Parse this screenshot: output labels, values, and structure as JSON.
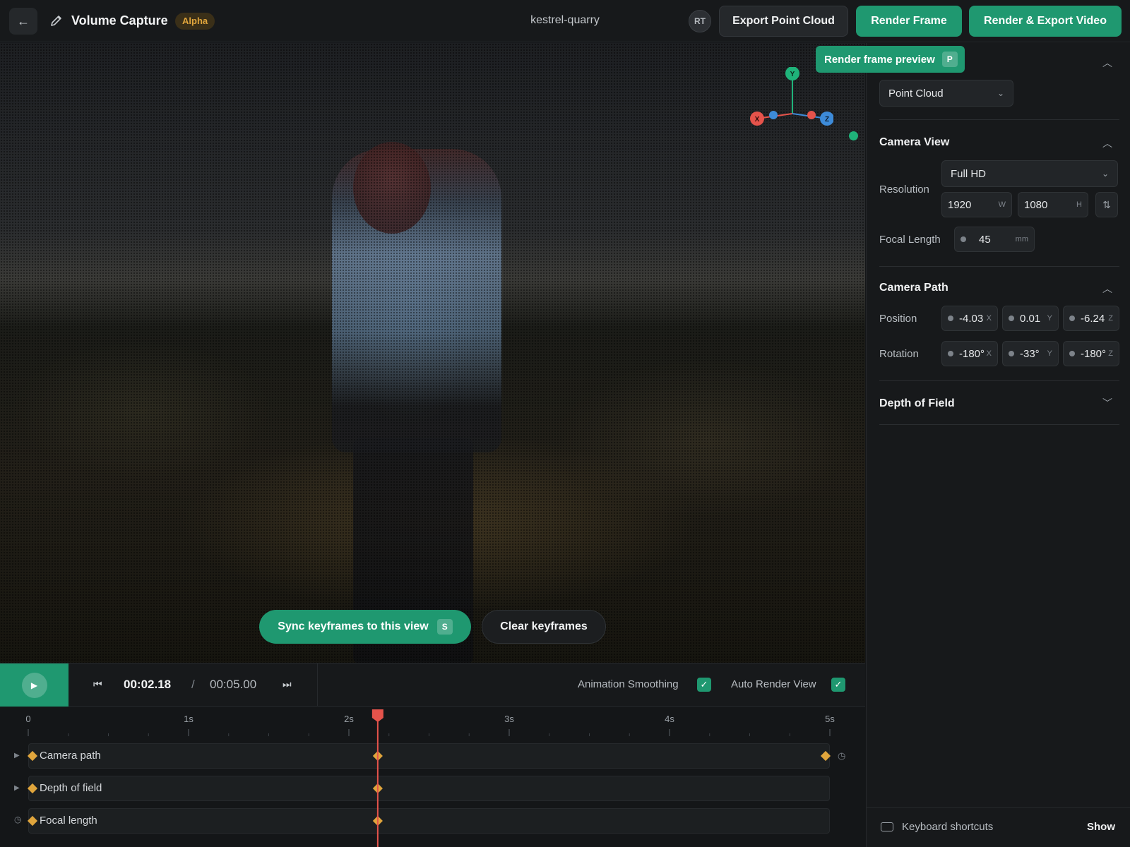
{
  "header": {
    "app_title": "Volume Capture",
    "badge": "Alpha",
    "project_name": "kestrel-quarry",
    "avatar_initials": "RT",
    "export_point_cloud": "Export Point Cloud",
    "render_frame": "Render Frame",
    "render_export_video": "Render & Export Video"
  },
  "viewport": {
    "tooltip_label": "Render frame preview",
    "tooltip_shortcut": "P",
    "gizmo_axes": [
      "X",
      "Y",
      "Z"
    ],
    "sync_label": "Sync keyframes to this view",
    "sync_shortcut": "S",
    "clear_label": "Clear keyframes"
  },
  "panel": {
    "render_mode": "Point Cloud",
    "camera_view": {
      "title": "Camera View",
      "resolution_label": "Resolution",
      "resolution_preset": "Full HD",
      "width": "1920",
      "width_suffix": "W",
      "height": "1080",
      "height_suffix": "H",
      "focal_label": "Focal Length",
      "focal_value": "45",
      "focal_unit": "mm"
    },
    "camera_path": {
      "title": "Camera Path",
      "position_label": "Position",
      "position": [
        {
          "value": "-4.03",
          "axis": "X"
        },
        {
          "value": "0.01",
          "axis": "Y"
        },
        {
          "value": "-6.24",
          "axis": "Z"
        }
      ],
      "rotation_label": "Rotation",
      "rotation": [
        {
          "value": "-180°",
          "axis": "X"
        },
        {
          "value": "-33°",
          "axis": "Y"
        },
        {
          "value": "-180°",
          "axis": "Z"
        }
      ]
    },
    "depth_of_field_title": "Depth of Field",
    "keyboard_shortcuts": "Keyboard shortcuts",
    "show_label": "Show"
  },
  "playback": {
    "current_time": "00:02.18",
    "separator": "/",
    "total_time": "00:05.00",
    "animation_smoothing": "Animation Smoothing",
    "animation_smoothing_on": true,
    "auto_render_view": "Auto Render View",
    "auto_render_view_on": true
  },
  "timeline": {
    "ticks": [
      "0",
      "1s",
      "2s",
      "3s",
      "4s",
      "5s"
    ],
    "duration_s": 5,
    "playhead_s": 2.18,
    "tracks": [
      {
        "label": "Camera path",
        "keyframes_s": [
          0,
          2.18,
          5
        ]
      },
      {
        "label": "Depth of field",
        "keyframes_s": [
          0,
          2.18
        ]
      },
      {
        "label": "Focal length",
        "keyframes_s": [
          0,
          2.18
        ]
      }
    ]
  },
  "colors": {
    "accent": "#1f9870",
    "keyframe": "#e0a53c",
    "playhead": "#e5534b",
    "axis_x": "#e5534b",
    "axis_y": "#1fb37a",
    "axis_z": "#3d8bd9"
  }
}
